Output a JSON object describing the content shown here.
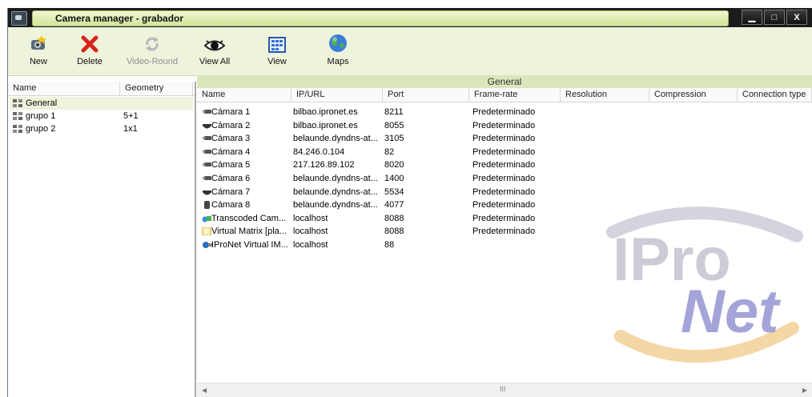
{
  "window": {
    "title": "Camera manager - grabador",
    "min": "▁",
    "max": "□",
    "close": "X"
  },
  "toolbar": [
    {
      "label": "New",
      "icon": "new-camera-icon",
      "disabled": false
    },
    {
      "label": "Delete",
      "icon": "delete-x-icon",
      "disabled": false
    },
    {
      "label": "Video-Round",
      "icon": "video-round-icon",
      "disabled": true
    },
    {
      "label": "View All",
      "icon": "eye-icon",
      "disabled": false
    },
    {
      "label": "View",
      "icon": "grid-view-icon",
      "disabled": false
    },
    {
      "label": "Maps",
      "icon": "globe-icon",
      "disabled": false
    }
  ],
  "section_title": "General",
  "left": {
    "columns": [
      "Name",
      "Geometry"
    ],
    "rows": [
      {
        "name": "General",
        "geometry": ""
      },
      {
        "name": "grupo 1",
        "geometry": "5+1"
      },
      {
        "name": "grupo 2",
        "geometry": "1x1"
      }
    ]
  },
  "right": {
    "columns": [
      "Name",
      "IP/URL",
      "Port",
      "Frame-rate",
      "Resolution",
      "Compression",
      "Connection type"
    ],
    "rows": [
      {
        "name": "Cámara 1",
        "ip": "bilbao.ipronet.es",
        "port": "8211",
        "fps": "Predeterminado",
        "icon": "camera-icon"
      },
      {
        "name": "Cámara 2",
        "ip": "bilbao.ipronet.es",
        "port": "8055",
        "fps": "Predeterminado",
        "icon": "dome-camera-icon"
      },
      {
        "name": "Cámara 3",
        "ip": "belaunde.dyndns-at...",
        "port": "3105",
        "fps": "Predeterminado",
        "icon": "camera-icon"
      },
      {
        "name": "Cámara 4",
        "ip": "84.246.0.104",
        "port": "82",
        "fps": "Predeterminado",
        "icon": "camera-icon"
      },
      {
        "name": "Cámara 5",
        "ip": "217.126.89.102",
        "port": "8020",
        "fps": "Predeterminado",
        "icon": "camera-icon"
      },
      {
        "name": "Cámara 6",
        "ip": "belaunde.dyndns-at...",
        "port": "1400",
        "fps": "Predeterminado",
        "icon": "camera-icon"
      },
      {
        "name": "Cámara 7",
        "ip": "belaunde.dyndns-at...",
        "port": "5534",
        "fps": "Predeterminado",
        "icon": "dome-camera-icon"
      },
      {
        "name": "Cámara 8",
        "ip": "belaunde.dyndns-at...",
        "port": "4077",
        "fps": "Predeterminado",
        "icon": "ptz-camera-icon"
      },
      {
        "name": "Transcoded Cam...",
        "ip": "localhost",
        "port": "8088",
        "fps": "Predeterminado",
        "icon": "transcoded-icon"
      },
      {
        "name": "Virtual Matrix [pla...",
        "ip": "localhost",
        "port": "8088",
        "fps": "Predeterminado",
        "icon": "virtual-matrix-icon"
      },
      {
        "name": "IProNet Virtual IM...",
        "ip": "localhost",
        "port": "88",
        "fps": "",
        "icon": "virtual-im-icon"
      }
    ]
  },
  "scroll": {
    "left": "◀",
    "right": "▶",
    "grip": "III"
  },
  "logo": {
    "line1": "IPro",
    "line2": "Net"
  },
  "colors": {
    "titlebar": "#1b1b1b",
    "title_pill": "#d2e49a",
    "toolbar_bg": "#eef3dc",
    "band": "#dbe6ba"
  }
}
